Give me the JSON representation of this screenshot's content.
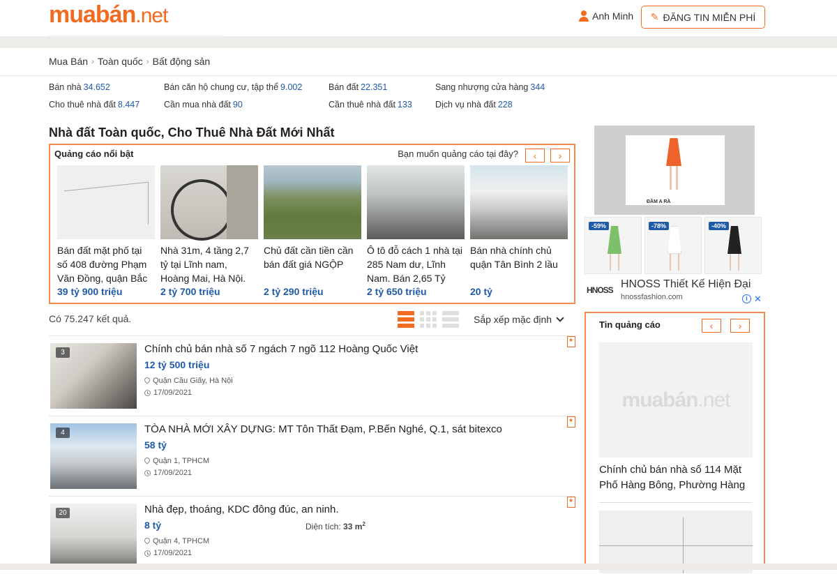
{
  "header": {
    "logo_main": "muabán",
    "logo_net": ".net",
    "user_name": "Anh Minh",
    "post_button": "ĐĂNG TIN MIỄN PHÍ"
  },
  "breadcrumb": [
    "Mua Bán",
    "Toàn quốc",
    "Bất động sản"
  ],
  "categories": [
    {
      "label": "Bán nhà",
      "count": "34.652"
    },
    {
      "label": "Bán căn hộ chung cư, tập thể",
      "count": "9.002"
    },
    {
      "label": "Bán đất",
      "count": "22.351"
    },
    {
      "label": "Sang nhượng cửa hàng",
      "count": "344"
    },
    {
      "label": "Cho thuê nhà đất",
      "count": "8.447"
    },
    {
      "label": "Cần mua nhà đất",
      "count": "90"
    },
    {
      "label": "Cần thuê nhà đất",
      "count": "133"
    },
    {
      "label": "Dịch vụ nhà đất",
      "count": "228"
    }
  ],
  "page_title": "Nhà đất Toàn quốc, Cho Thuê Nhà Đất Mới Nhất",
  "featured": {
    "title": "Quảng cáo nổi bật",
    "ask": "Bạn muốn quảng cáo tại đây?",
    "prev": "‹",
    "next": "›",
    "items": [
      {
        "text": "Bán đất mặt phố tại số 408 đường Phạm Văn Đồng, quận Bắc",
        "price": "39 tỷ 900 triệu"
      },
      {
        "text": "Nhà 31m, 4 tầng 2,7 tỷ tại Lĩnh nam, Hoàng Mai, Hà Nội.",
        "price": "2 tỷ 700 triệu"
      },
      {
        "text": "Chủ đất cần tiền cần bán đất giá NGỘP",
        "price": "2 tỷ 290 triệu"
      },
      {
        "text": "Ô tô đỗ cách 1 nhà tại 285 Nam dư, Lĩnh Nam. Bán 2,65 Tỷ",
        "price": "2 tỷ 650 triệu"
      },
      {
        "text": "Bán nhà chính chủ quận Tân Bình 2 lầu",
        "price": "20 tỷ"
      }
    ]
  },
  "results": {
    "count_text": "Có 75.247 kết quả.",
    "sort_label": "Sắp xếp mặc định"
  },
  "listings": [
    {
      "photos": "3",
      "title": "Chính chủ bán nhà số 7 ngách 7 ngõ 112 Hoàng Quốc Việt",
      "price": "12 tỷ 500 triệu",
      "area": "",
      "location": "Quận Cầu Giấy, Hà Nội",
      "date": "17/09/2021"
    },
    {
      "photos": "4",
      "title": "TÒA NHÀ MỚI XÂY DỰNG: MT Tôn Thất Đạm, P.Bến Nghé, Q.1, sát bitexco",
      "price": "58 tỷ",
      "area": "",
      "location": "Quận 1, TPHCM",
      "date": "17/09/2021"
    },
    {
      "photos": "20",
      "title": "Nhà đẹp, thoáng, KDC đông đúc, an ninh.",
      "price": "8 tỷ",
      "area_label": "Diện tích:",
      "area_value": "33 m",
      "area_unit_sup": "2",
      "location": "Quận 4, TPHCM",
      "date": "17/09/2021"
    }
  ],
  "ads": {
    "top_caption": "ĐẦM A RÀ",
    "products": [
      {
        "badge": "-59%",
        "color": "#7cc06a"
      },
      {
        "badge": "-78%",
        "color": "#f4f4f4"
      },
      {
        "badge": "-40%",
        "color": "#222222"
      }
    ],
    "brand_logo": "HNOSS",
    "brand_title": "HNOSS Thiết Kế Hiện Đại",
    "brand_url": "hnossfashion.com",
    "info_glyph": "i",
    "close_glyph": "✕"
  },
  "ad_box": {
    "title": "Tin quảng cáo",
    "prev": "‹",
    "next": "›",
    "logo_main": "muabán",
    "logo_net": ".net",
    "text": "Chính chủ bán nhà số 114 Mặt Phố Hàng Bông, Phường Hàng"
  },
  "colors": {
    "brand_orange": "#f26b21",
    "price_blue": "#1e5aa8"
  }
}
